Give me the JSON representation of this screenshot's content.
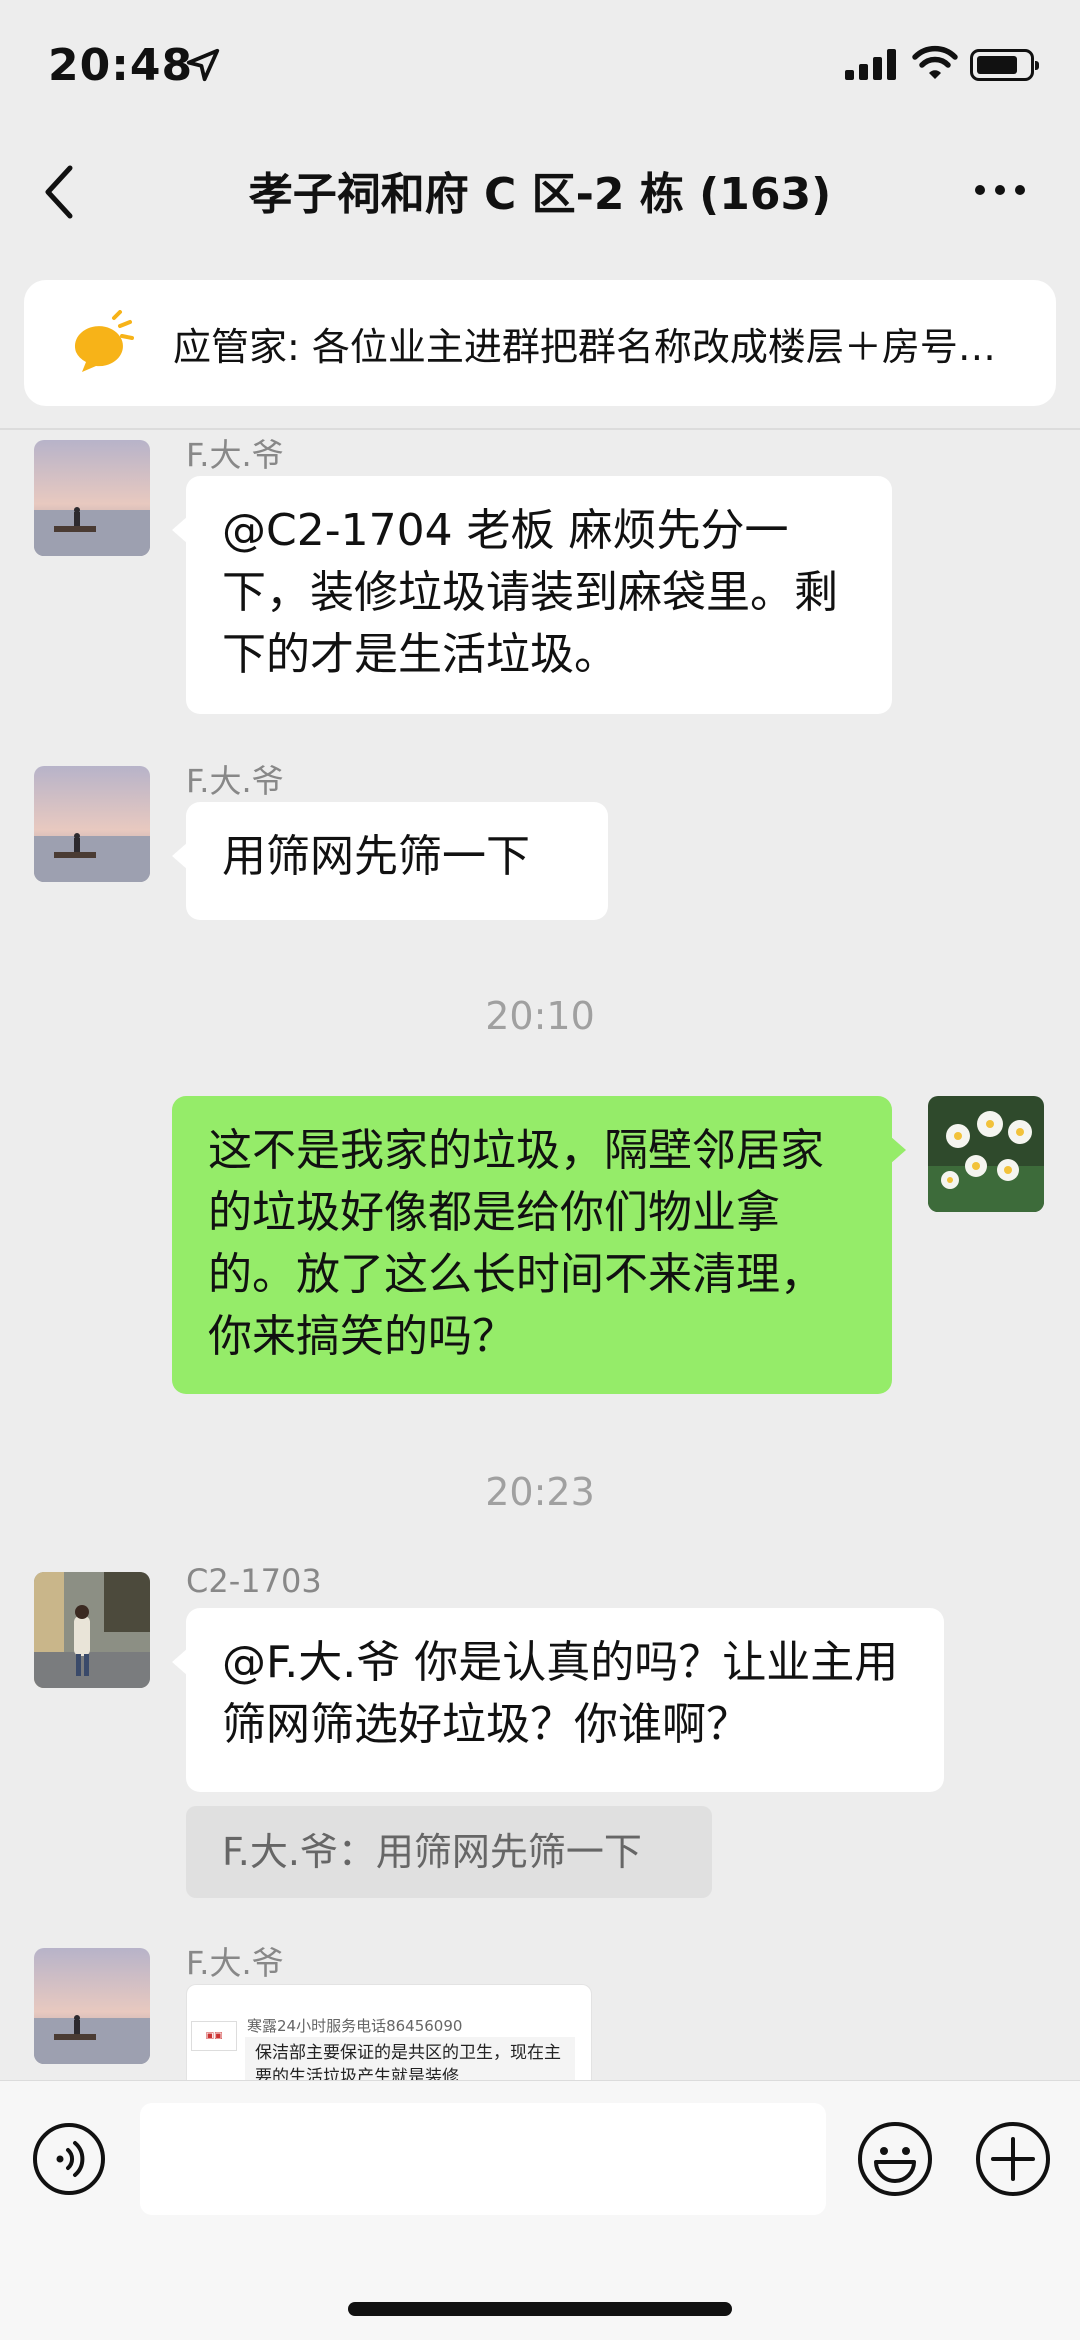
{
  "status_bar": {
    "time": "20:48"
  },
  "nav": {
    "title": "孝子祠和府 C 区-2 栋 (163)"
  },
  "announcement": {
    "text": "应管家: 各位业主进群把群名称改成楼层＋房号，方便沟通"
  },
  "messages": [
    {
      "sender": "F.大.爷",
      "text": "@C2-1704 老板 麻烦先分一下，装修垃圾请装到麻袋里。剩下的才是生活垃圾。"
    },
    {
      "sender": "F.大.爷",
      "text": "用筛网先筛一下"
    },
    {
      "time": "20:10"
    },
    {
      "text": "这不是我家的垃圾，隔壁邻居家的垃圾好像都是给你们物业拿的。放了这么长时间不来清理，你来搞笑的吗？"
    },
    {
      "time": "20:23"
    },
    {
      "sender": "C2-1703",
      "text": "@F.大.爷 你是认真的吗？让业主用筛网筛选好垃圾？你谁啊？",
      "quote": "F.大.爷：用筛网先筛一下"
    },
    {
      "sender": "F.大.爷",
      "card_header": "寒露24小时服务电话86456090",
      "card_text": "保洁部主要保证的是共区的卫生，现在主要的生活垃圾产生就是装修"
    }
  ],
  "icons": {
    "voice": "voice-icon",
    "emoji": "emoji-icon",
    "plus": "plus-icon",
    "back": "back-icon",
    "more": "more-icon"
  },
  "colors": {
    "self_bubble": "#95ec69",
    "background": "#ededed"
  }
}
